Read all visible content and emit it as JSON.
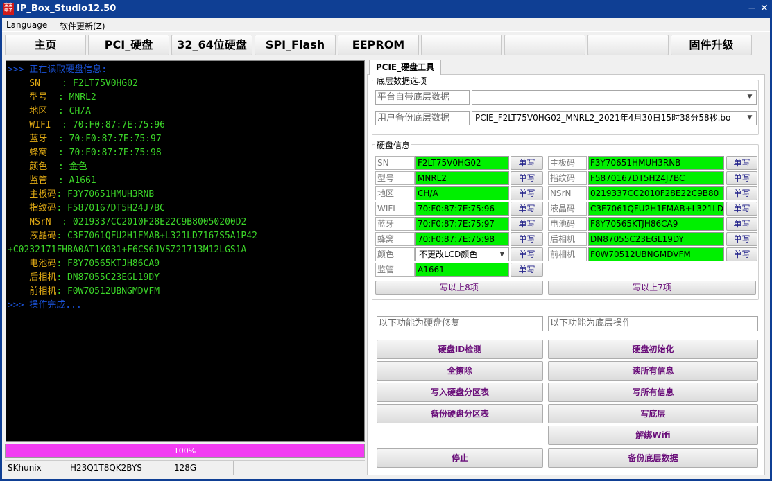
{
  "window": {
    "title": "IP_Box_Studio12.50",
    "icon_text": "宝宝 电子",
    "controls": {
      "minimize": "−",
      "close": "✕"
    }
  },
  "menu": {
    "language": "Language",
    "update": "软件更新(Z)"
  },
  "main_tabs": [
    "主页",
    "PCI_硬盘",
    "32_64位硬盘",
    "SPI_Flash",
    "EEPROM",
    "",
    "",
    "",
    "固件升级"
  ],
  "console": {
    "lines": [
      {
        "text": ">>> 正在读取硬盘信息:",
        "color": "#1a52d8"
      },
      {
        "key": "    SN    ",
        "value": ": F2LT75V0HG02"
      },
      {
        "key": "    型号  ",
        "value": ": MNRL2"
      },
      {
        "key": "    地区  ",
        "value": ": CH/A"
      },
      {
        "key": "    WIFI  ",
        "value": ": 70:F0:87:7E:75:96"
      },
      {
        "key": "    蓝牙  ",
        "value": ": 70:F0:87:7E:75:97"
      },
      {
        "key": "    蜂窝  ",
        "value": ": 70:F0:87:7E:75:98"
      },
      {
        "key": "    颜色  ",
        "value": ": 金色"
      },
      {
        "key": "    监管  ",
        "value": ": A1661"
      },
      {
        "key": "    主板码",
        "value": ": F3Y70651HMUH3RNB"
      },
      {
        "key": "    指纹码",
        "value": ": F5870167DT5H24J7BC"
      },
      {
        "key": "    NSrN  ",
        "value": ": 0219337CC2010F28E22C9B80050200D2"
      },
      {
        "key": "    液晶码",
        "value": ": C3F7061QFU2H1FMAB+L321LD7167S5A1P42"
      },
      {
        "text": "+C0232171FHBA0AT1K031+F6CS6JVSZ21713M12LGS1A",
        "color": "#3cd629"
      },
      {
        "key": "    电池码",
        "value": ": F8Y70565KTJH86CA9"
      },
      {
        "key": "    后相机",
        "value": ": DN87055C23EGL19DY"
      },
      {
        "key": "    前相机",
        "value": ": F0W70512UBNGMDVFM"
      },
      {
        "text": ">>> 操作完成...",
        "color": "#1a52d8"
      }
    ]
  },
  "progress": {
    "label": "100%",
    "percent": 100,
    "color": "#f23cf2"
  },
  "status": {
    "vendor": "SKhunix",
    "serial": "H23Q1T8QK2BYS",
    "capacity": "128G",
    "extra": ""
  },
  "pcie_tab": {
    "title": "PCIE_硬盘工具"
  },
  "low_level": {
    "group_label": "底层数据选项",
    "platform_label": "平台自带底层数据",
    "platform_value": "",
    "backup_label": "用户备份底层数据",
    "backup_value": "PCIE_F2LT75V0HG02_MNRL2_2021年4月30日15时38分58秒.bo"
  },
  "disk_info": {
    "group_label": "硬盘信息",
    "left": [
      {
        "label": "SN",
        "value": "F2LT75V0HG02",
        "button": "单写"
      },
      {
        "label": "型号",
        "value": "MNRL2",
        "button": "单写"
      },
      {
        "label": "地区",
        "value": "CH/A",
        "button": "单写"
      },
      {
        "label": "WIFI",
        "value": "70:F0:87:7E:75:96",
        "button": "单写"
      },
      {
        "label": "蓝牙",
        "value": "70:F0:87:7E:75:97",
        "button": "单写"
      },
      {
        "label": "蜂窝",
        "value": "70:F0:87:7E:75:98",
        "button": "单写"
      },
      {
        "label": "颜色",
        "value": "不更改LCD颜色",
        "button": "单写",
        "type": "combo"
      },
      {
        "label": "监管",
        "value": "A1661",
        "button": "单写"
      }
    ],
    "right": [
      {
        "label": "主板码",
        "value": "F3Y70651HMUH3RNB",
        "button": "单写"
      },
      {
        "label": "指纹码",
        "value": "F5870167DT5H24J7BC",
        "button": "单写"
      },
      {
        "label": "NSrN",
        "value": "0219337CC2010F28E22C9B80",
        "button": "单写"
      },
      {
        "label": "液晶码",
        "value": "C3F7061QFU2H1FMAB+L321LD",
        "button": "单写"
      },
      {
        "label": "电池码",
        "value": "F8Y70565KTJH86CA9",
        "button": "单写"
      },
      {
        "label": "后相机",
        "value": "DN87055C23EGL19DY",
        "button": "单写"
      },
      {
        "label": "前相机",
        "value": "F0W70512UBNGMDVFM",
        "button": "单写"
      }
    ],
    "write_left": "写以上8项",
    "write_right": "写以上7项"
  },
  "functions": {
    "left_header": "以下功能为硬盘修复",
    "right_header": "以下功能为底层操作",
    "left_buttons": [
      "硬盘ID检测",
      "全擦除",
      "写入硬盘分区表",
      "备份硬盘分区表",
      "停止"
    ],
    "right_buttons": [
      "硬盘初始化",
      "读所有信息",
      "写所有信息",
      "写底层",
      "解绑Wifi",
      "备份底层数据"
    ]
  },
  "colors": {
    "title_bar": "#0f3f94",
    "field_green": "#00f000",
    "button_text": "#6a0f7a",
    "console_green": "#3cd629",
    "console_blue": "#1a52d8",
    "console_orange": "#e0aa14"
  }
}
